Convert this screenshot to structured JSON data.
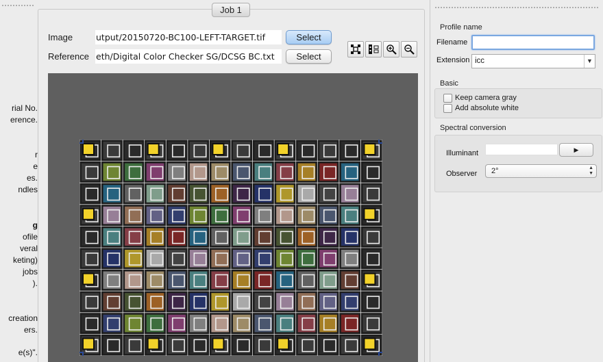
{
  "help_pane": {
    "lines": [
      {
        "text": "rial No."
      },
      {
        "text": "erence."
      },
      {
        "text": "r"
      },
      {
        "text": "e"
      },
      {
        "text": "es."
      },
      {
        "text": "ndles"
      },
      {
        "text": "g"
      },
      {
        "text": "ofile"
      },
      {
        "text": "veral"
      },
      {
        "text": "keting)"
      },
      {
        "text": "jobs"
      },
      {
        "text": ")."
      },
      {
        "text": "creation"
      },
      {
        "text": "ers."
      },
      {
        "text": "e(s)\"."
      }
    ]
  },
  "job": {
    "tab_label": "Job 1",
    "image_label": "Image",
    "image_path": "utput/20150720-BC100-LEFT-TARGET.tif",
    "image_select": "Select",
    "reference_label": "Reference",
    "reference_path": "eth/Digital Color Checker SG/DCSG BC.txt",
    "reference_select": "Select",
    "tools": [
      {
        "icon": "fit-grid-icon"
      },
      {
        "icon": "align-columns-icon"
      },
      {
        "icon": "zoom-in-icon"
      },
      {
        "icon": "zoom-out-icon"
      }
    ]
  },
  "target_chart": {
    "rows": 10,
    "cols": 14,
    "colors": {
      "frame": "#1d1d1d",
      "grid": "#dcdcdc",
      "viewer_bg": "#5f5f5f",
      "marker_yellow": "#f2d22a",
      "corner_handle": "#2a4a9a"
    }
  },
  "profile": {
    "section_title": "Profile name",
    "filename_label": "Filename",
    "filename_value": "",
    "extension_label": "Extension",
    "extension_value": "icc"
  },
  "basic": {
    "section_title": "Basic",
    "keep_gray": "Keep camera gray",
    "add_white": "Add absolute white"
  },
  "spectral": {
    "section_title": "Spectral conversion",
    "illuminant_label": "Illuminant",
    "illuminant_value": "",
    "observer_label": "Observer",
    "observer_value": "2°"
  },
  "colors": {
    "accent_focus": "#7aa7e0",
    "select_active": "#a8cdf3"
  }
}
